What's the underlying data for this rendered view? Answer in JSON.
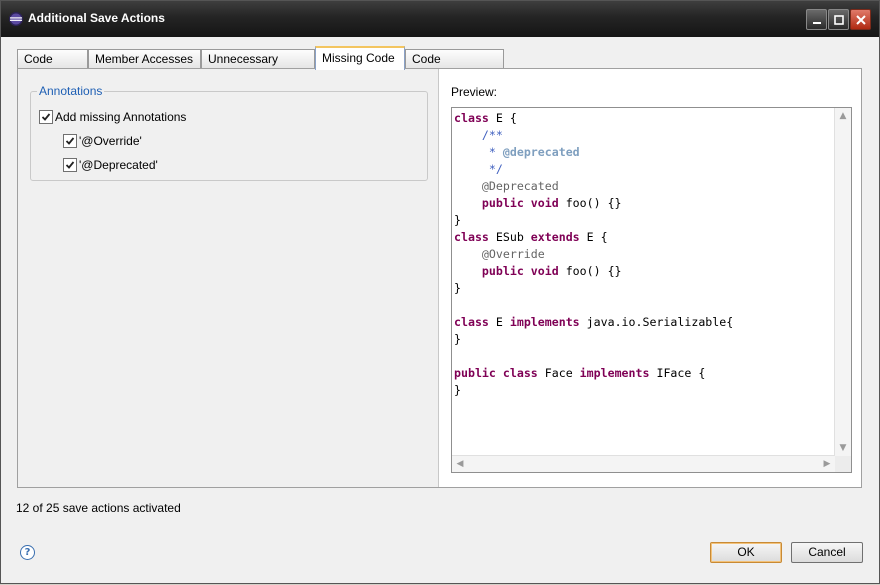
{
  "window": {
    "title": "Additional Save Actions"
  },
  "tabs": [
    {
      "label": "Code Style",
      "active": false
    },
    {
      "label": "Member Accesses",
      "active": false
    },
    {
      "label": "Unnecessary Code",
      "active": false
    },
    {
      "label": "Missing Code",
      "active": true
    },
    {
      "label": "Code Organizing",
      "active": false
    }
  ],
  "annotations_group": {
    "label": "Annotations",
    "add_missing": {
      "label": "Add missing Annotations",
      "checked": true
    },
    "override": {
      "label": "'@Override'",
      "checked": true
    },
    "deprecated": {
      "label": "'@Deprecated'",
      "checked": true
    }
  },
  "preview": {
    "label": "Preview:",
    "code_lines": [
      "class E {",
      "    /**",
      "     * @deprecated",
      "     */",
      "    @Deprecated",
      "    public void foo() {}",
      "}",
      "class ESub extends E {",
      "    @Override",
      "    public void foo() {}",
      "}",
      "",
      "class E implements java.io.Serializable{",
      "}",
      "",
      "public class Face implements IFace {",
      "}"
    ]
  },
  "status": {
    "text": "12 of 25 save actions activated"
  },
  "buttons": {
    "ok": "OK",
    "cancel": "Cancel"
  },
  "icons": {
    "help": "help-icon",
    "app": "eclipse-icon"
  }
}
